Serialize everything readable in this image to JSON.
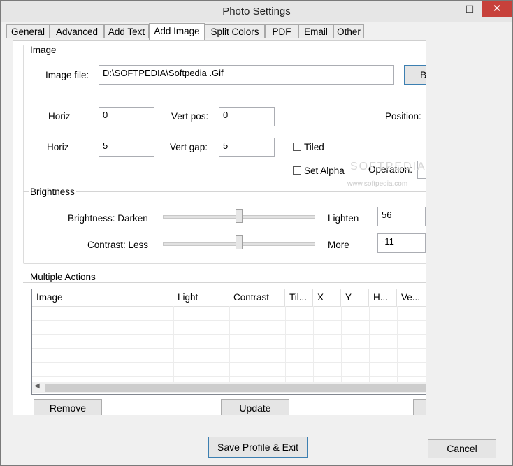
{
  "window": {
    "title": "Photo Settings"
  },
  "title_buttons": {
    "minimize": "—",
    "maximize": "☐",
    "close": "✕"
  },
  "tabs": [
    "General",
    "Advanced",
    "Add Text",
    "Add Image",
    "Split Colors",
    "PDF",
    "Email",
    "Other"
  ],
  "active_tab": "Add Image",
  "image_group": {
    "title": "Image",
    "file_label": "Image file:",
    "file_value": "D:\\SOFTPEDIA\\Softpedia .Gif",
    "browse_label": "B",
    "horiz_label_1": "Horiz",
    "horiz_value_1": "0",
    "vert_pos_label": "Vert pos:",
    "vert_pos_value": "0",
    "position_label": "Position:",
    "horiz_label_2": "Horiz",
    "horiz_value_2": "5",
    "vert_gap_label": "Vert gap:",
    "vert_gap_value": "5",
    "tiled_label": "Tiled",
    "set_alpha_label": "Set Alpha",
    "operation_label": "Operation:"
  },
  "brightness_group": {
    "title": "Brightness",
    "brightness_left": "Brightness: Darken",
    "brightness_right": "Lighten",
    "brightness_value": "56",
    "contrast_left": "Contrast: Less",
    "contrast_right": "More",
    "contrast_value": "-11"
  },
  "actions_group": {
    "title": "Multiple Actions",
    "columns": [
      "Image",
      "Light",
      "Contrast",
      "Til...",
      "X",
      "Y",
      "H...",
      "Ve..."
    ],
    "remove_label": "Remove",
    "update_label": "Update"
  },
  "footer": {
    "save_label": "Save Profile & Exit",
    "cancel_label": "Cancel"
  },
  "watermark": {
    "text1": "SOFTPEDIA",
    "text2": "www.softpedia.com"
  }
}
